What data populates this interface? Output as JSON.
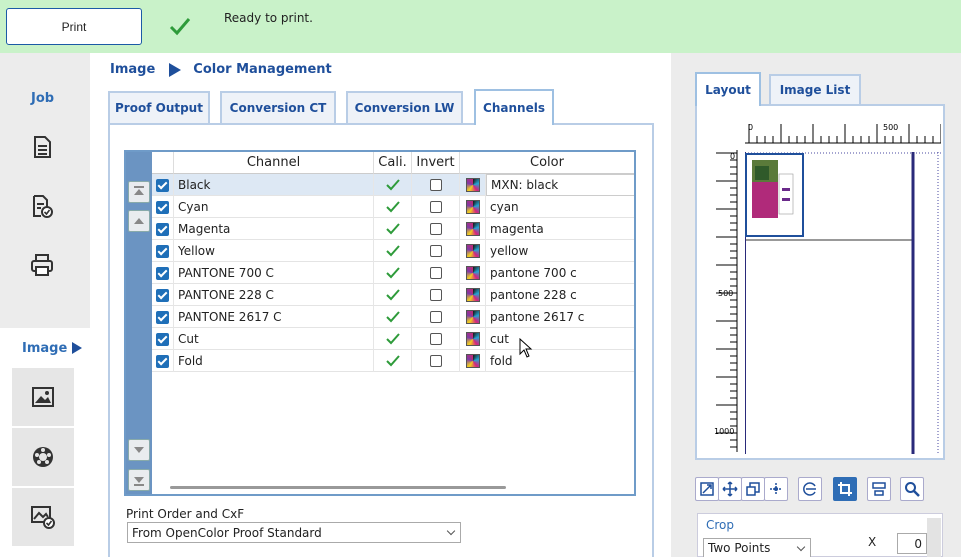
{
  "toolbar": {
    "print_label": "Print",
    "status_text": "Ready to print."
  },
  "leftnav": {
    "job_label": "Job",
    "image_label": "Image",
    "icons": [
      "document-icon",
      "document-check-icon",
      "printer-icon",
      "image-icon",
      "color-wheel-icon",
      "image-check-icon"
    ]
  },
  "breadcrumb": {
    "first": "Image",
    "second": "Color Management"
  },
  "tabs": [
    {
      "label": "Proof Output"
    },
    {
      "label": "Conversion CT"
    },
    {
      "label": "Conversion LW"
    },
    {
      "label": "Channels"
    }
  ],
  "channels_table": {
    "headers": {
      "channel": "Channel",
      "cali": "Cali.",
      "invert": "Invert",
      "color": "Color"
    },
    "rows": [
      {
        "channel": "Black",
        "color": "MXN: black",
        "enabled": true,
        "cali": true,
        "invert": false
      },
      {
        "channel": "Cyan",
        "color": "cyan",
        "enabled": true,
        "cali": true,
        "invert": false
      },
      {
        "channel": "Magenta",
        "color": "magenta",
        "enabled": true,
        "cali": true,
        "invert": false
      },
      {
        "channel": "Yellow",
        "color": "yellow",
        "enabled": true,
        "cali": true,
        "invert": false
      },
      {
        "channel": "PANTONE 700 C",
        "color": "pantone 700 c",
        "enabled": true,
        "cali": true,
        "invert": false
      },
      {
        "channel": "PANTONE 228 C",
        "color": "pantone 228 c",
        "enabled": true,
        "cali": true,
        "invert": false
      },
      {
        "channel": "PANTONE 2617 C",
        "color": "pantone 2617 c",
        "enabled": true,
        "cali": true,
        "invert": false
      },
      {
        "channel": "Cut",
        "color": "cut",
        "enabled": true,
        "cali": true,
        "invert": false
      },
      {
        "channel": "Fold",
        "color": "fold",
        "enabled": true,
        "cali": true,
        "invert": false
      }
    ]
  },
  "print_order": {
    "label": "Print Order and CxF",
    "selected": "From OpenColor Proof Standard"
  },
  "right_panel": {
    "tabs": [
      {
        "label": "Layout"
      },
      {
        "label": "Image List"
      }
    ],
    "ruler_top_labels": [
      "0",
      "500"
    ],
    "ruler_left_labels": [
      "0",
      "500",
      "1000"
    ],
    "crop_label": "Crop",
    "crop_mode": "Two Points",
    "x_label": "X",
    "x_value": "0"
  },
  "colors": {
    "status_bar": "#c9f2c9",
    "accent": "#1f4f9b",
    "checkbox": "#1f6fb8",
    "check_green": "#2e9b3a"
  }
}
